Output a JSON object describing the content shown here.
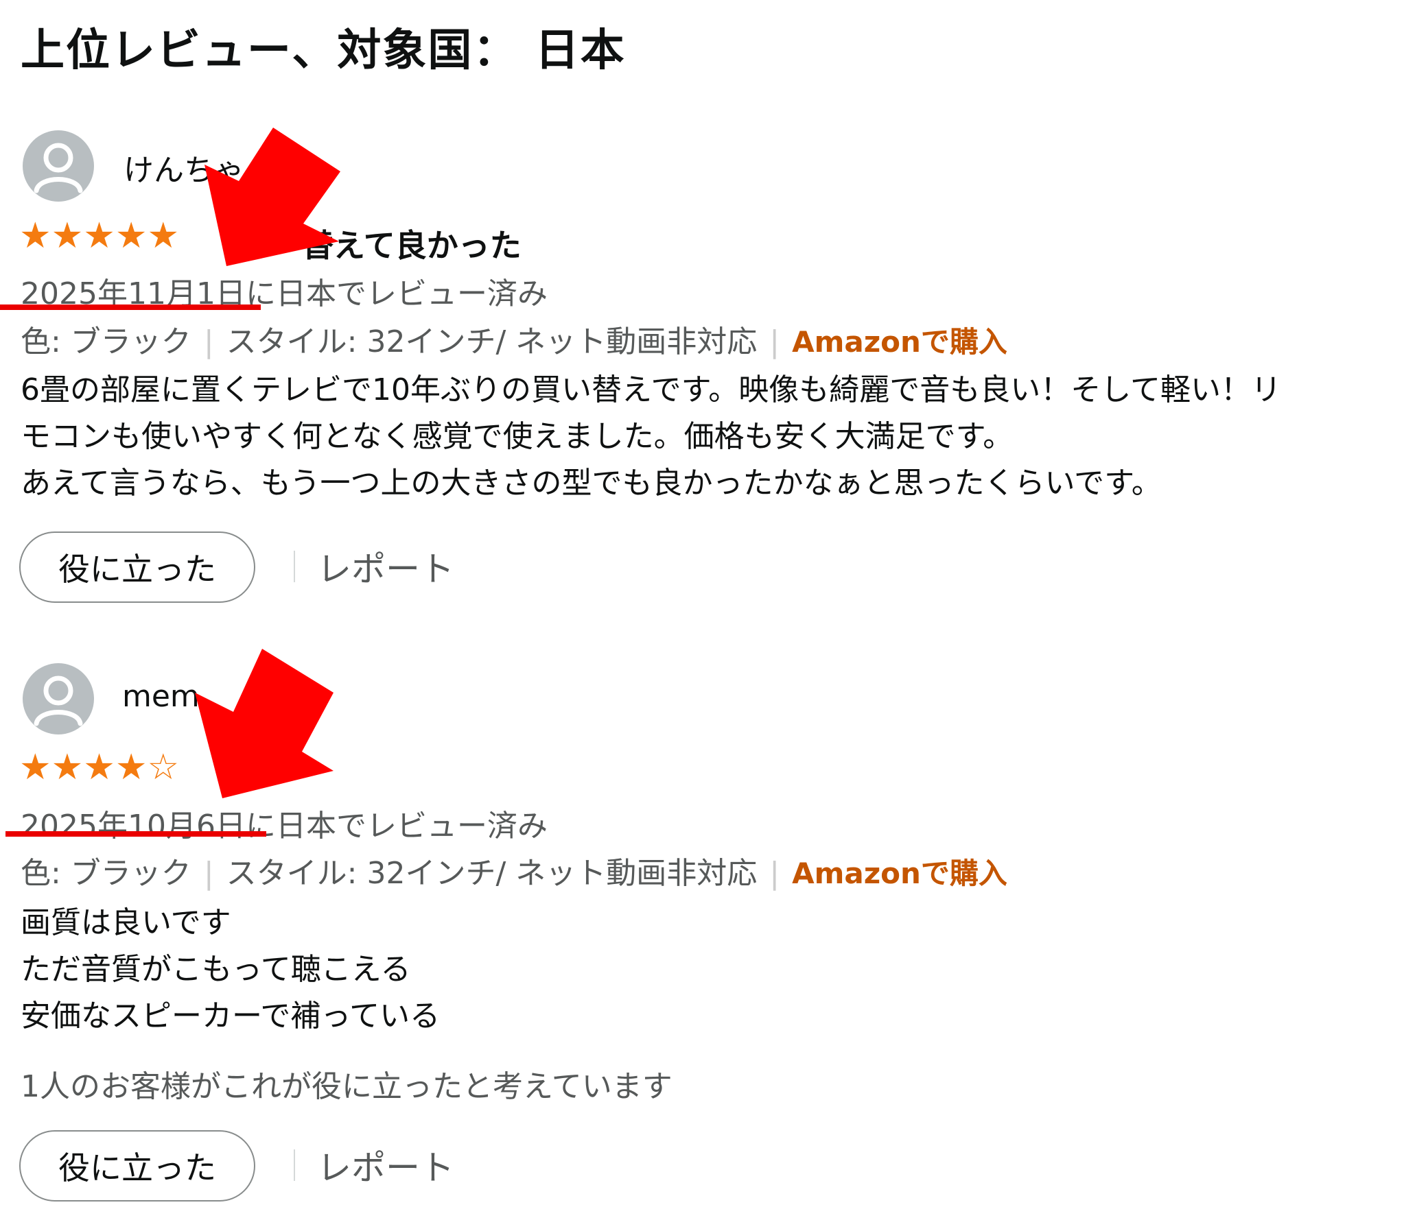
{
  "heading": "上位レビュー、対象国： 日本",
  "reviews": [
    {
      "author": "けんちゃ",
      "stars_text": "★★★★★",
      "rating": 5,
      "title": "替えて良かった",
      "date": "2025年11月1日",
      "date_suffix": "に日本でレビュー済み",
      "color_label": "色: ブラック",
      "style_label": "スタイル: 32インチ/ ネット動画非対応",
      "verified": "Amazonで購入",
      "body": "6畳の部屋に置くテレビで10年ぶりの買い替えです。映像も綺麗で音も良い！そして軽い！リ\nモコンも使いやすく何となく感覚で使えました。価格も安く大満足です。\nあえて言うなら、もう一つ上の大きさの型でも良かったかなぁと思ったくらいです。",
      "helpful_button": "役に立った",
      "report": "レポート"
    },
    {
      "author": "mem",
      "stars_text": "★★★★",
      "stars_empty_text": "☆",
      "rating": 4,
      "title": "",
      "date": "2025年10月6日",
      "date_suffix": "に日本でレビュー済み",
      "color_label": "色: ブラック",
      "style_label": "スタイル: 32インチ/ ネット動画非対応",
      "verified": "Amazonで購入",
      "body": "画質は良いです\nただ音質がこもって聴こえる\n安価なスピーカーで補っている",
      "helpful_count": "1人のお客様がこれが役に立ったと考えています",
      "helpful_button": "役に立った",
      "report": "レポート"
    }
  ],
  "colors": {
    "star": "#f47b10",
    "verified": "#c45500",
    "annotation": "#ea0000"
  },
  "icons": [
    "avatar-icon",
    "red-arrow-annotation",
    "red-underline-annotation"
  ]
}
